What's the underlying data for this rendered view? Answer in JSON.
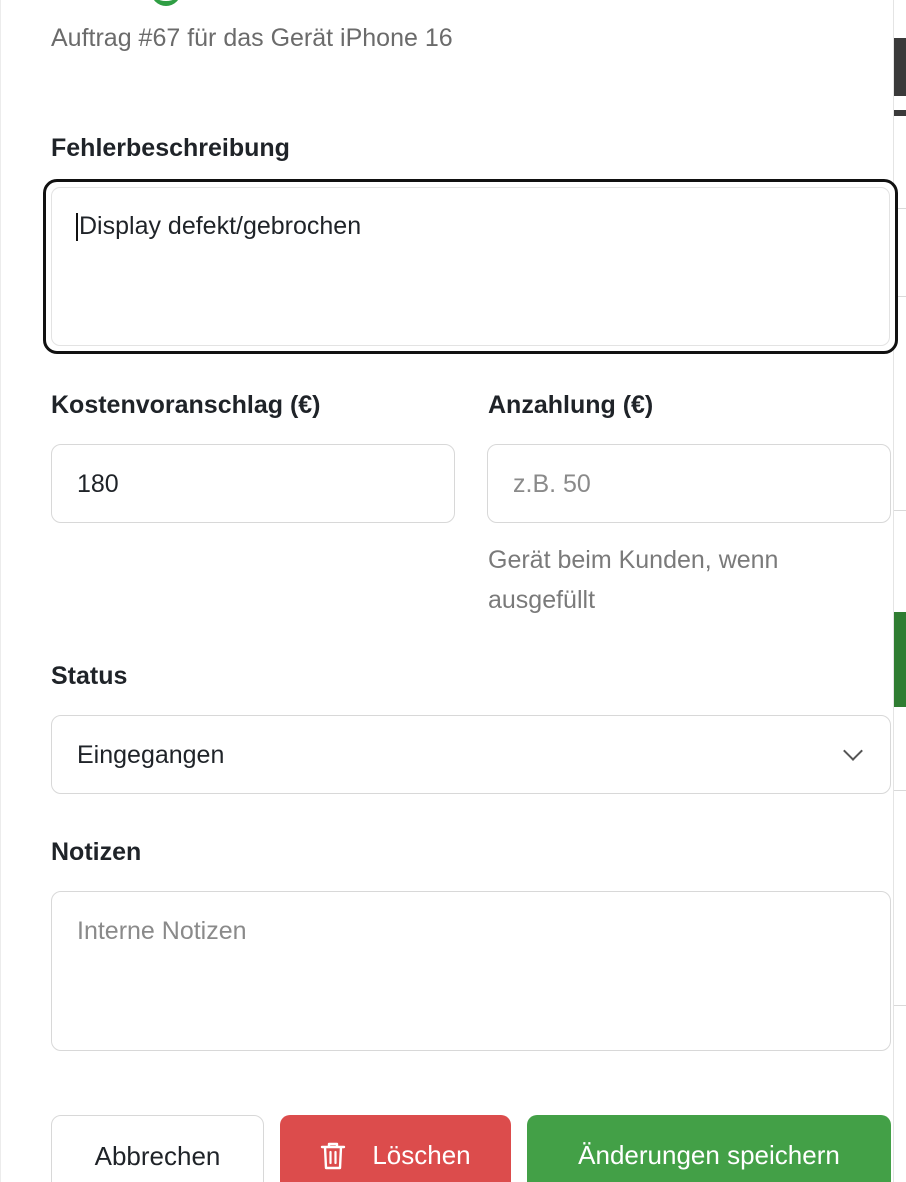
{
  "header": {
    "subtitle": "Auftrag #67 für das Gerät iPhone 16"
  },
  "form": {
    "error_label": "Fehlerbeschreibung",
    "error_value": "Display defekt/gebrochen",
    "estimate_label": "Kostenvoranschlag (€)",
    "estimate_value": "180",
    "deposit_label": "Anzahlung (€)",
    "deposit_placeholder": "z.B. 50",
    "deposit_help": "Gerät beim Kunden, wenn ausgefüllt",
    "status_label": "Status",
    "status_value": "Eingegangen",
    "notes_label": "Notizen",
    "notes_placeholder": "Interne Notizen"
  },
  "actions": {
    "cancel_label": "Abbrechen",
    "delete_label": "Löschen",
    "save_label": "Änderungen speichern"
  },
  "colors": {
    "accent_green": "#43a047",
    "danger_red": "#dc4c4c",
    "focus_border": "#111111"
  },
  "icons": {
    "delete": "trash-icon",
    "status_dropdown": "chevron-down-icon"
  }
}
